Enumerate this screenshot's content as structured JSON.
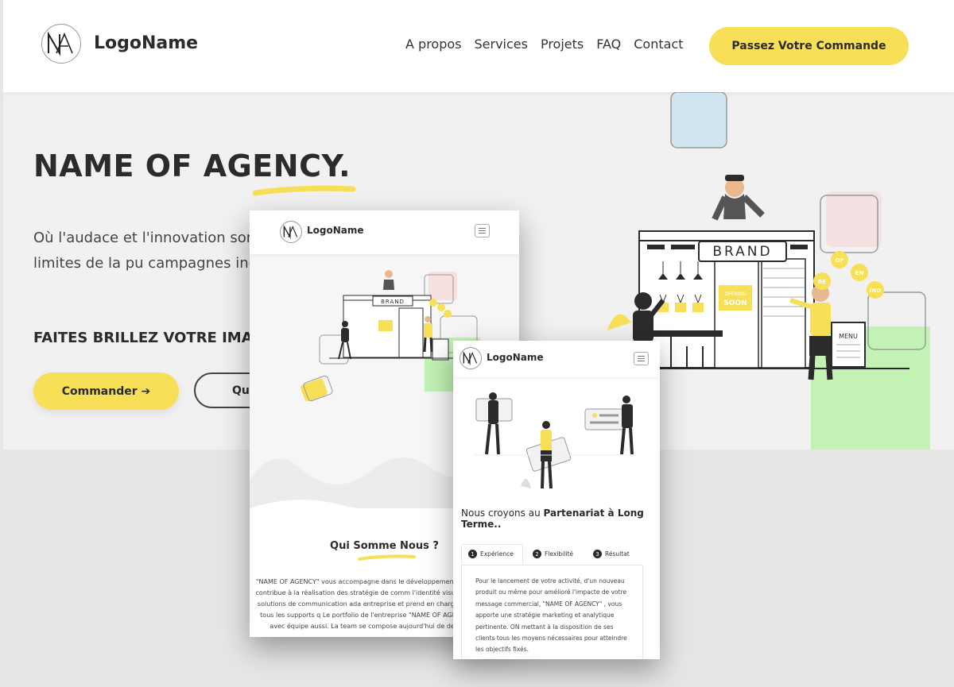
{
  "colors": {
    "accent": "#f7df58",
    "text": "#2b2b2b",
    "hero_bg": "#f1f1f1",
    "page_bg": "#e6e6e4"
  },
  "brand": {
    "logo_text": "LogoName"
  },
  "desktop": {
    "nav": {
      "links": [
        "A propos",
        "Services",
        "Projets",
        "FAQ",
        "Contact"
      ],
      "cta_label": "Passez Votre Commande"
    },
    "hero": {
      "title": "NAME OF AGENCY.",
      "description": "Où l'audace et l'innovation son repoussons les limites de la pu campagnes inoubliables.",
      "tagline": "FAITES BRILLEZ VOTRE IMA",
      "primary_button": "Commander ➔",
      "secondary_button": "Qui",
      "illustration_sign": "BRAND",
      "illustration_soon": [
        "OPENING",
        "SOON"
      ],
      "illustration_menu": "MENU",
      "illustration_balloons": [
        "OP",
        "EN",
        "INO",
        "RE"
      ]
    }
  },
  "mobile_about": {
    "section_title_prefix": "Qui ",
    "section_title_highlight": "Somme Nous",
    "section_title_suffix": " ?",
    "body": "\"NAME OF AGENCY\" vous accompagne dans le développement marque ainsi elle contribue à la réalisation des stratégie de comm l'identité visuel en trouvant des solutions de communication ada entreprise et prend en charge la réalisation de tous les supports q Le portfolio de l'entreprise \"NAME OF AGENCY\" s'est élargi avec équipe aussi. La team se compose aujourd'hui de designers, de co"
  },
  "mobile_partner": {
    "heading_prefix": "Nous croyons au ",
    "heading_bold": "Partenariat à Long Terme..",
    "tabs": [
      {
        "number": "1",
        "label": "Expérience"
      },
      {
        "number": "2",
        "label": "Flexibilité"
      },
      {
        "number": "3",
        "label": "Résultat"
      }
    ],
    "body": "Pour le lancement de votre activité, d'un nouveau produit ou même pour amélioré l'impacte de votre message commercial, \"NAME OF AGENCY\" , vous apporte une stratégie marketing et analytique pertinente. ON mettant à la disposition de ses clients tous les moyens nécessaires pour atteindre les objectifs fixés."
  }
}
